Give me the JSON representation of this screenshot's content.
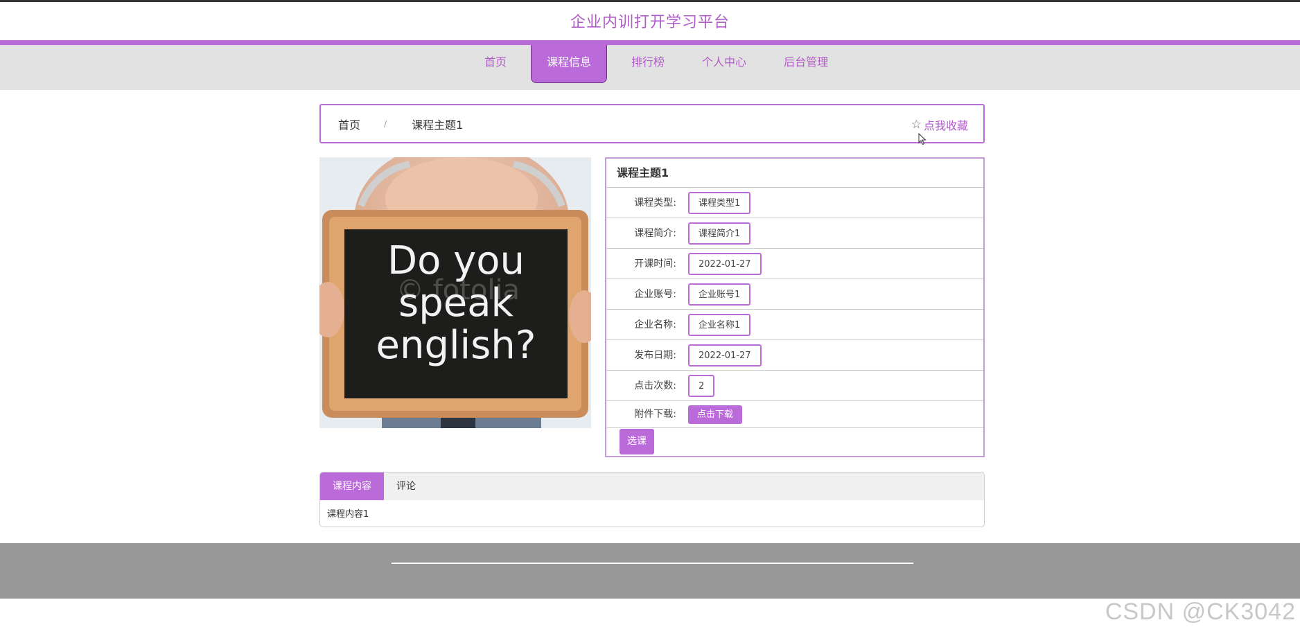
{
  "site": {
    "title": "企业内训打开学习平台"
  },
  "nav": {
    "items": [
      {
        "label": "首页"
      },
      {
        "label": "课程信息"
      },
      {
        "label": "排行榜"
      },
      {
        "label": "个人中心"
      },
      {
        "label": "后台管理"
      }
    ],
    "active_index": 1
  },
  "breadcrumb": {
    "home": "首页",
    "separator": "/",
    "current": "课程主题1",
    "favorite_label": "点我收藏"
  },
  "photo": {
    "sign_lines": [
      "Do you",
      "speak",
      "english?"
    ],
    "watermark": "© fotolia"
  },
  "detail": {
    "title": "课程主题1",
    "fields": [
      {
        "label": "课程类型:",
        "value": "课程类型1"
      },
      {
        "label": "课程简介:",
        "value": "课程简介1"
      },
      {
        "label": "开课时间:",
        "value": "2022-01-27"
      },
      {
        "label": "企业账号:",
        "value": "企业账号1"
      },
      {
        "label": "企业名称:",
        "value": "企业名称1"
      },
      {
        "label": "发布日期:",
        "value": "2022-01-27"
      },
      {
        "label": "点击次数:",
        "value": "2"
      }
    ],
    "download_label": "附件下载:",
    "download_button": "点击下载",
    "choose_button": "选课"
  },
  "tabs": {
    "items": [
      {
        "label": "课程内容"
      },
      {
        "label": "评论"
      }
    ],
    "content": "课程内容1"
  },
  "watermark": "CSDN @CK3042",
  "colors": {
    "accent": "#bb6bd9",
    "title_text": "#b05cc8",
    "nav_bg": "#e2e2e2",
    "footer_bg": "#999999"
  }
}
